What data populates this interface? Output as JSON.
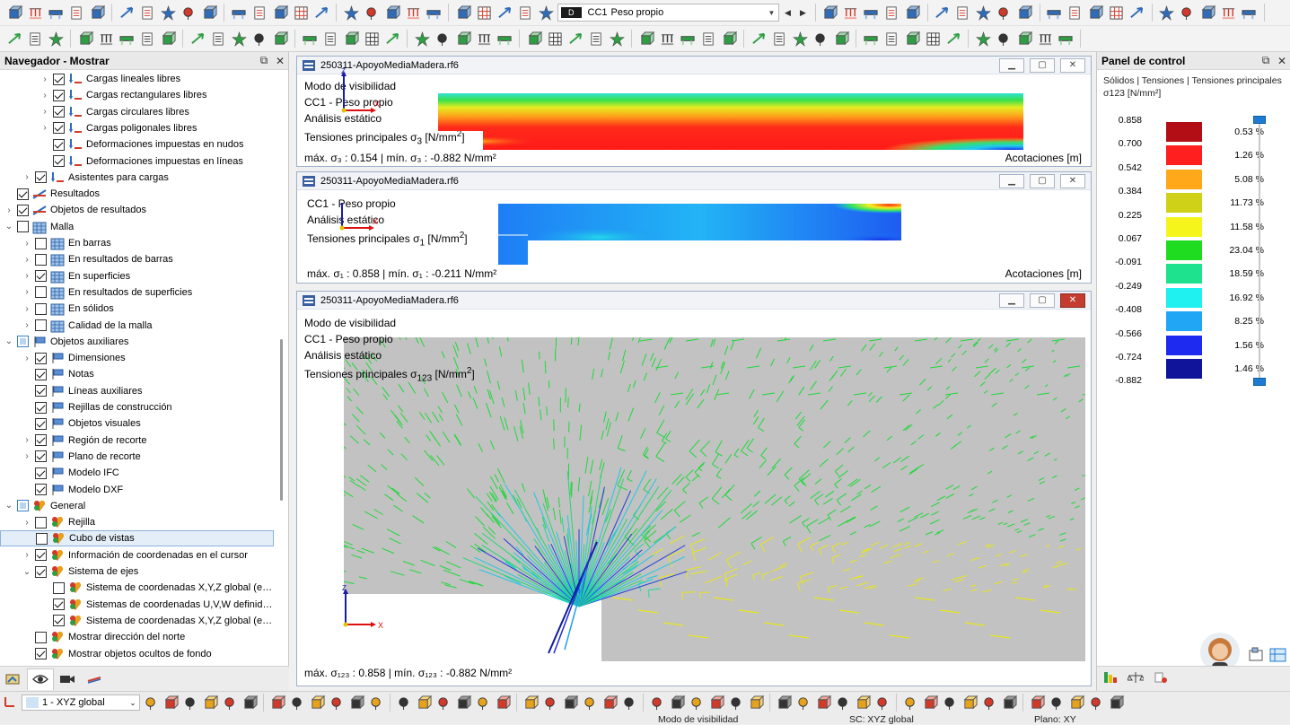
{
  "toolbar1": {
    "load_case_badge": "D",
    "load_case_code": "CC1",
    "load_case_name": "Peso propio"
  },
  "navigator": {
    "title": "Navegador - Mostrar",
    "items": [
      {
        "label": "Cargas lineales libres",
        "level": 2,
        "exp": "›",
        "state": "on",
        "icon": "load"
      },
      {
        "label": "Cargas rectangulares libres",
        "level": 2,
        "exp": "›",
        "state": "on",
        "icon": "load"
      },
      {
        "label": "Cargas circulares libres",
        "level": 2,
        "exp": "›",
        "state": "on",
        "icon": "load"
      },
      {
        "label": "Cargas poligonales libres",
        "level": 2,
        "exp": "›",
        "state": "on",
        "icon": "load"
      },
      {
        "label": "Deformaciones impuestas en nudos",
        "level": 2,
        "exp": "",
        "state": "on",
        "icon": "load"
      },
      {
        "label": "Deformaciones impuestas en líneas",
        "level": 2,
        "exp": "",
        "state": "on",
        "icon": "load"
      },
      {
        "label": "Asistentes para cargas",
        "level": 1,
        "exp": "›",
        "state": "on",
        "icon": "load"
      },
      {
        "label": "Resultados",
        "level": 0,
        "exp": "",
        "state": "on",
        "icon": "results"
      },
      {
        "label": "Objetos de resultados",
        "level": 0,
        "exp": "›",
        "state": "on",
        "icon": "results"
      },
      {
        "label": "Malla",
        "level": 0,
        "exp": "⌄",
        "state": "off",
        "icon": "mesh"
      },
      {
        "label": "En barras",
        "level": 1,
        "exp": "›",
        "state": "off",
        "icon": "mesh"
      },
      {
        "label": "En resultados de barras",
        "level": 1,
        "exp": "›",
        "state": "off",
        "icon": "mesh"
      },
      {
        "label": "En superficies",
        "level": 1,
        "exp": "›",
        "state": "on",
        "icon": "mesh"
      },
      {
        "label": "En resultados de superficies",
        "level": 1,
        "exp": "›",
        "state": "off",
        "icon": "mesh"
      },
      {
        "label": "En sólidos",
        "level": 1,
        "exp": "›",
        "state": "off",
        "icon": "mesh"
      },
      {
        "label": "Calidad de la malla",
        "level": 1,
        "exp": "›",
        "state": "off",
        "icon": "mesh"
      },
      {
        "label": "Objetos auxiliares",
        "level": 0,
        "exp": "⌄",
        "state": "part",
        "icon": "aux"
      },
      {
        "label": "Dimensiones",
        "level": 1,
        "exp": "›",
        "state": "on",
        "icon": "aux"
      },
      {
        "label": "Notas",
        "level": 1,
        "exp": "",
        "state": "on",
        "icon": "aux"
      },
      {
        "label": "Líneas auxiliares",
        "level": 1,
        "exp": "",
        "state": "on",
        "icon": "aux"
      },
      {
        "label": "Rejillas de construcción",
        "level": 1,
        "exp": "",
        "state": "on",
        "icon": "aux"
      },
      {
        "label": "Objetos visuales",
        "level": 1,
        "exp": "",
        "state": "on",
        "icon": "aux"
      },
      {
        "label": "Región de recorte",
        "level": 1,
        "exp": "›",
        "state": "on",
        "icon": "aux"
      },
      {
        "label": "Plano de recorte",
        "level": 1,
        "exp": "›",
        "state": "on",
        "icon": "aux"
      },
      {
        "label": "Modelo IFC",
        "level": 1,
        "exp": "",
        "state": "on",
        "icon": "aux"
      },
      {
        "label": "Modelo DXF",
        "level": 1,
        "exp": "",
        "state": "on",
        "icon": "aux"
      },
      {
        "label": "General",
        "level": 0,
        "exp": "⌄",
        "state": "part",
        "icon": "general"
      },
      {
        "label": "Rejilla",
        "level": 1,
        "exp": "›",
        "state": "off",
        "icon": "general"
      },
      {
        "label": "Cubo de vistas",
        "level": 1,
        "exp": "",
        "state": "off",
        "icon": "general",
        "selected": true
      },
      {
        "label": "Información de coordenadas en el cursor",
        "level": 1,
        "exp": "›",
        "state": "on",
        "icon": "general"
      },
      {
        "label": "Sistema de ejes",
        "level": 1,
        "exp": "⌄",
        "state": "on",
        "icon": "general"
      },
      {
        "label": "Sistema de coordenadas X,Y,Z global (en ...",
        "level": 2,
        "exp": "",
        "state": "off",
        "icon": "general"
      },
      {
        "label": "Sistemas de coordenadas U,V,W definidos...",
        "level": 2,
        "exp": "",
        "state": "on",
        "icon": "general"
      },
      {
        "label": "Sistema de coordenadas X,Y,Z global (en ...",
        "level": 2,
        "exp": "",
        "state": "on",
        "icon": "general"
      },
      {
        "label": "Mostrar dirección del norte",
        "level": 1,
        "exp": "",
        "state": "off",
        "icon": "general"
      },
      {
        "label": "Mostrar objetos ocultos de fondo",
        "level": 1,
        "exp": "",
        "state": "on",
        "icon": "general"
      }
    ]
  },
  "windows": [
    {
      "title": "250311-ApoyoMediaMadera.rf6",
      "lines": [
        "Modo de visibilidad",
        "CC1 - Peso propio",
        "Análisis estático"
      ],
      "stress_label": "Tensiones principales σ",
      "stress_sub": "3",
      "stress_unit": " [N/mm",
      "stress_sup": "2",
      "stress_end": "]",
      "footer": "máx. σ₃ : 0.154 | mín. σ₃ : -0.882 N/mm²",
      "footer_right": "Acotaciones [m]"
    },
    {
      "title": "250311-ApoyoMediaMadera.rf6",
      "lines": [
        "CC1 - Peso propio",
        "Análisis estático"
      ],
      "stress_label": "Tensiones principales σ",
      "stress_sub": "1",
      "stress_unit": " [N/mm",
      "stress_sup": "2",
      "stress_end": "]",
      "footer": "máx. σ₁ : 0.858 | mín. σ₁ : -0.211 N/mm²",
      "footer_right": "Acotaciones [m]"
    },
    {
      "title": "250311-ApoyoMediaMadera.rf6",
      "lines": [
        "Modo de visibilidad",
        "CC1 - Peso propio",
        "Análisis estático"
      ],
      "stress_label": "Tensiones principales σ",
      "stress_sub": "123",
      "stress_unit": " [N/mm",
      "stress_sup": "2",
      "stress_end": "]",
      "footer": "máx. σ₁₂₃ : 0.858 | mín. σ₁₂₃ : -0.882 N/mm²"
    }
  ],
  "axis_labels": {
    "x": "X",
    "z": "Z"
  },
  "control_panel": {
    "title": "Panel de control",
    "subtitle_line1": "Sólidos | Tensiones | Tensiones principales",
    "subtitle_line2": "σ123 [N/mm²]",
    "legend_values": [
      "0.858",
      "0.700",
      "0.542",
      "0.384",
      "0.225",
      "0.067",
      "-0.091",
      "-0.249",
      "-0.408",
      "-0.566",
      "-0.724",
      "-0.882"
    ],
    "legend_colors": [
      "#b30e16",
      "#ff1f1f",
      "#ffa81a",
      "#cfd118",
      "#f5f51c",
      "#20dc20",
      "#1fe28e",
      "#1ff0f0",
      "#20a6f5",
      "#1f2af0",
      "#10149a"
    ],
    "legend_percents": [
      "0.53 %",
      "1.26 %",
      "5.08 %",
      "11.73 %",
      "11.58 %",
      "23.04 %",
      "18.59 %",
      "16.92 %",
      "8.25 %",
      "1.56 %",
      "1.46 %"
    ]
  },
  "status": {
    "view_combo": "1 - XYZ global",
    "mode": "Modo de visibilidad",
    "cs": "SC: XYZ global",
    "plane": "Plano: XY"
  }
}
